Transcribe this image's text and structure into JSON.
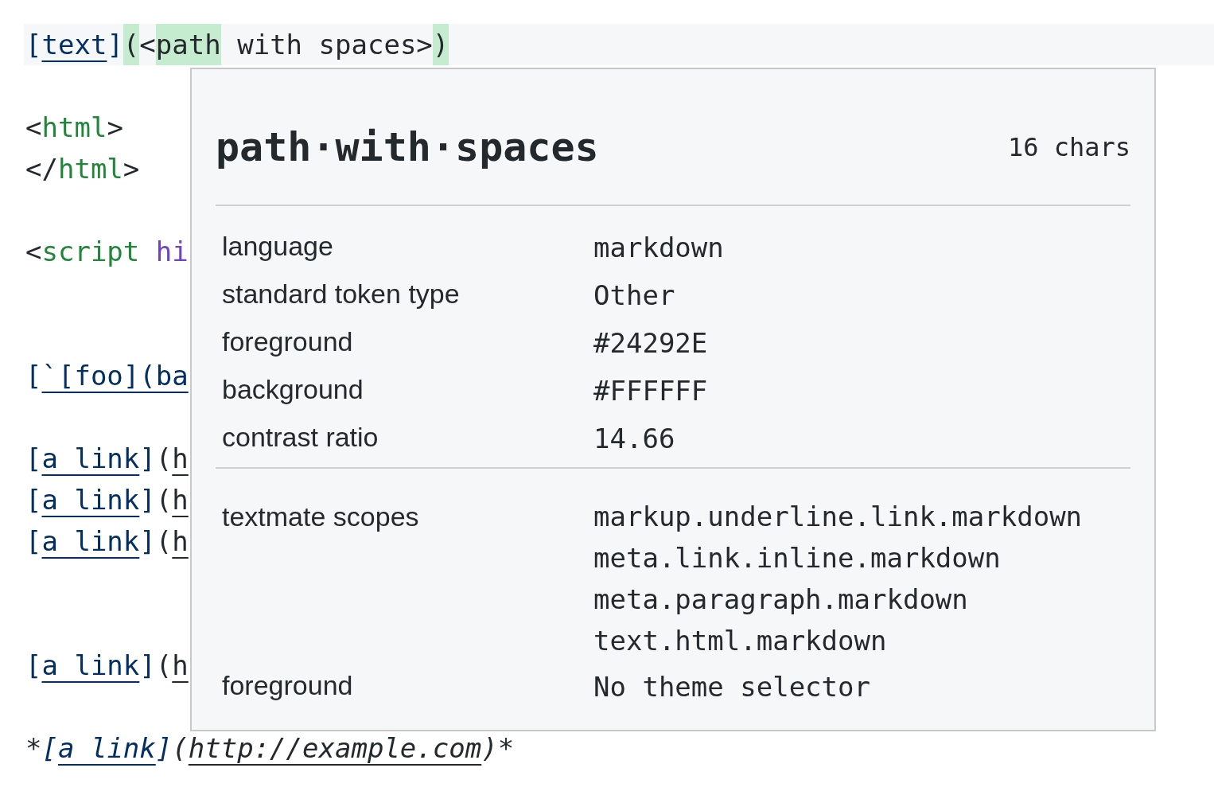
{
  "editor": {
    "lines": [
      {
        "kind": "code",
        "current": true,
        "tokens": [
          {
            "text": "[",
            "kind": "link-text"
          },
          {
            "text": "text",
            "kind": "link-text",
            "underline": true
          },
          {
            "text": "]",
            "kind": "link-text"
          },
          {
            "text": "(",
            "kind": "plain",
            "highlight": true
          },
          {
            "text": "<",
            "kind": "plain"
          },
          {
            "text": "path",
            "kind": "plain",
            "highlight": true
          },
          {
            "text": " with spaces>",
            "kind": "plain"
          },
          {
            "text": ")",
            "kind": "plain",
            "highlight": true
          }
        ]
      },
      {
        "kind": "blank"
      },
      {
        "kind": "code",
        "tokens": [
          {
            "text": "<",
            "kind": "plain"
          },
          {
            "text": "html",
            "kind": "tag"
          },
          {
            "text": ">",
            "kind": "plain"
          }
        ]
      },
      {
        "kind": "code",
        "tokens": [
          {
            "text": "</",
            "kind": "plain"
          },
          {
            "text": "html",
            "kind": "tag"
          },
          {
            "text": ">",
            "kind": "plain"
          }
        ]
      },
      {
        "kind": "blank"
      },
      {
        "kind": "code",
        "tokens": [
          {
            "text": "<",
            "kind": "plain"
          },
          {
            "text": "script",
            "kind": "tag"
          },
          {
            "text": " hi",
            "kind": "attr"
          }
        ]
      },
      {
        "kind": "blank"
      },
      {
        "kind": "blank"
      },
      {
        "kind": "code",
        "tokens": [
          {
            "text": "[",
            "kind": "link-text"
          },
          {
            "text": "`[foo](ba",
            "kind": "link-text",
            "underline": true
          }
        ]
      },
      {
        "kind": "blank"
      },
      {
        "kind": "code",
        "tokens": [
          {
            "text": "[",
            "kind": "link-text"
          },
          {
            "text": "a link",
            "kind": "link-text",
            "underline": true
          },
          {
            "text": "]",
            "kind": "link-text"
          },
          {
            "text": "(",
            "kind": "plain"
          },
          {
            "text": "h",
            "kind": "plain",
            "underline": true
          }
        ]
      },
      {
        "kind": "code",
        "tokens": [
          {
            "text": "[",
            "kind": "link-text"
          },
          {
            "text": "a link",
            "kind": "link-text",
            "underline": true
          },
          {
            "text": "]",
            "kind": "link-text"
          },
          {
            "text": "(",
            "kind": "plain"
          },
          {
            "text": "h",
            "kind": "plain",
            "underline": true
          }
        ]
      },
      {
        "kind": "code",
        "tokens": [
          {
            "text": "[",
            "kind": "link-text"
          },
          {
            "text": "a link",
            "kind": "link-text",
            "underline": true
          },
          {
            "text": "]",
            "kind": "link-text"
          },
          {
            "text": "(",
            "kind": "plain"
          },
          {
            "text": "h",
            "kind": "plain",
            "underline": true
          }
        ]
      },
      {
        "kind": "blank"
      },
      {
        "kind": "blank"
      },
      {
        "kind": "code",
        "tokens": [
          {
            "text": "[",
            "kind": "link-text"
          },
          {
            "text": "a link",
            "kind": "link-text",
            "underline": true
          },
          {
            "text": "]",
            "kind": "link-text"
          },
          {
            "text": "(",
            "kind": "plain"
          },
          {
            "text": "h",
            "kind": "plain",
            "underline": true
          }
        ]
      },
      {
        "kind": "blank"
      },
      {
        "kind": "code",
        "tokens": [
          {
            "text": "*",
            "kind": "plain"
          },
          {
            "text": "[",
            "kind": "link-text",
            "italic": true
          },
          {
            "text": "a link",
            "kind": "link-text",
            "italic": true,
            "underline": true
          },
          {
            "text": "]",
            "kind": "link-text",
            "italic": true
          },
          {
            "text": "(",
            "kind": "plain",
            "italic": true
          },
          {
            "text": "http://example.com",
            "kind": "plain",
            "italic": true,
            "underline": true
          },
          {
            "text": ")",
            "kind": "plain",
            "italic": true
          },
          {
            "text": "*",
            "kind": "plain"
          }
        ]
      }
    ]
  },
  "hover": {
    "title": "path·with·spaces",
    "count": "16 chars",
    "sections": [
      {
        "rows": [
          {
            "label": "language",
            "value": [
              "markdown"
            ]
          },
          {
            "label": "standard token type",
            "value": [
              "Other"
            ]
          },
          {
            "label": "foreground",
            "value": [
              "#24292E"
            ]
          },
          {
            "label": "background",
            "value": [
              "#FFFFFF"
            ]
          },
          {
            "label": "contrast ratio",
            "value": [
              "14.66"
            ]
          }
        ]
      },
      {
        "rows": [
          {
            "label": "textmate scopes",
            "value": [
              "markup.underline.link.markdown",
              "meta.link.inline.markdown",
              "meta.paragraph.markdown",
              "text.html.markdown"
            ]
          },
          {
            "label": "foreground",
            "value": [
              "No theme selector"
            ]
          }
        ]
      }
    ]
  }
}
